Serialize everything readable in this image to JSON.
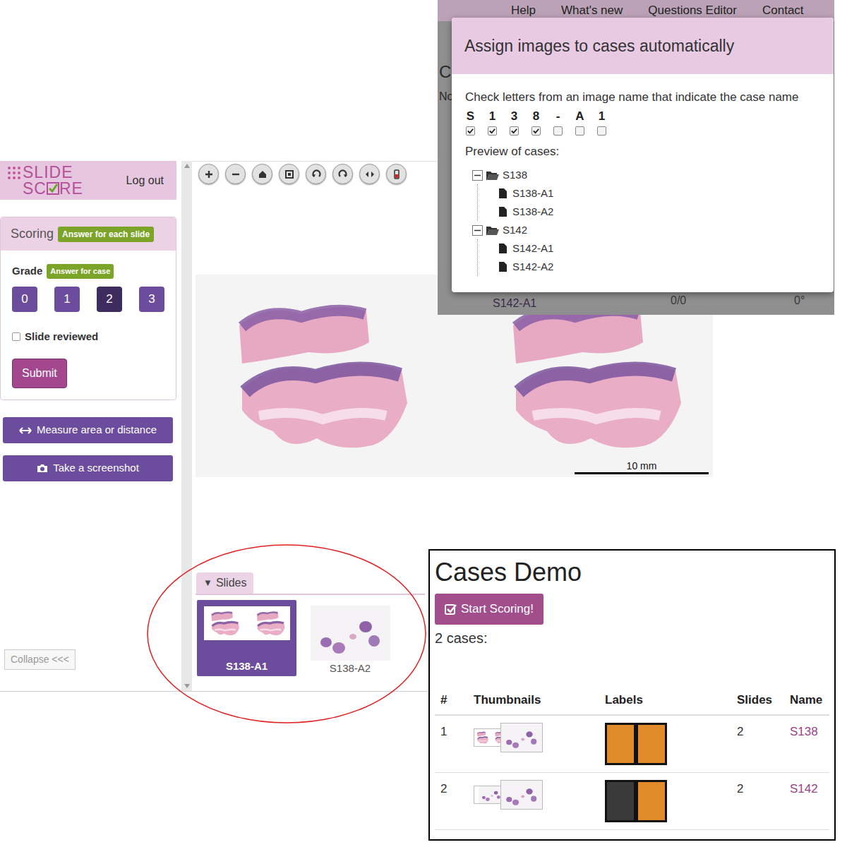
{
  "viewer": {
    "logo": [
      "SLIDE",
      "SC",
      "RE"
    ],
    "logout": "Log out",
    "scoring": {
      "title": "Scoring",
      "badge": "Answer for each slide"
    },
    "grade": {
      "label": "Grade",
      "badge": "Answer for case",
      "options": [
        {
          "label": "0",
          "selected": false
        },
        {
          "label": "1",
          "selected": false
        },
        {
          "label": "2",
          "selected": true
        },
        {
          "label": "3",
          "selected": false
        }
      ]
    },
    "reviewed": {
      "label": "Slide reviewed",
      "checked": false
    },
    "submit": "Submit",
    "tools": [
      "Measure area or distance",
      "Take a screenshot"
    ],
    "collapse": "Collapse <<<",
    "scale": "10 mm",
    "slides_tab": {
      "arrow": "▼",
      "label": "Slides"
    },
    "slides": [
      {
        "name": "S138-A1",
        "selected": true
      },
      {
        "name": "S138-A2",
        "selected": false
      }
    ]
  },
  "dialog": {
    "nav": [
      "Help",
      "What's new",
      "Questions Editor",
      "Contact"
    ],
    "behind": {
      "heading": "C",
      "note": "No",
      "row": [
        "S142-A1",
        "0/0",
        "0°"
      ]
    },
    "title": "Assign images to cases automatically",
    "instruction": "Check letters from an image name that indicate the case name",
    "letters": [
      {
        "char": "S",
        "checked": true
      },
      {
        "char": "1",
        "checked": true
      },
      {
        "char": "3",
        "checked": true
      },
      {
        "char": "8",
        "checked": true
      },
      {
        "char": "-",
        "checked": false
      },
      {
        "char": "A",
        "checked": false
      },
      {
        "char": "1",
        "checked": false
      }
    ],
    "preview_label": "Preview of cases:",
    "tree": [
      {
        "name": "S138",
        "expanded": true,
        "children": [
          "S138-A1",
          "S138-A2"
        ]
      },
      {
        "name": "S142",
        "expanded": true,
        "children": [
          "S142-A1",
          "S142-A2"
        ]
      }
    ]
  },
  "cases": {
    "title": "Cases Demo",
    "start": "Start Scoring!",
    "count": "2 cases:",
    "columns": [
      "#",
      "Thumbnails",
      "Labels",
      "Slides",
      "Name"
    ],
    "rows": [
      {
        "index": "1",
        "slides": "2",
        "name": "S138"
      },
      {
        "index": "2",
        "slides": "2",
        "name": "S142"
      }
    ]
  }
}
